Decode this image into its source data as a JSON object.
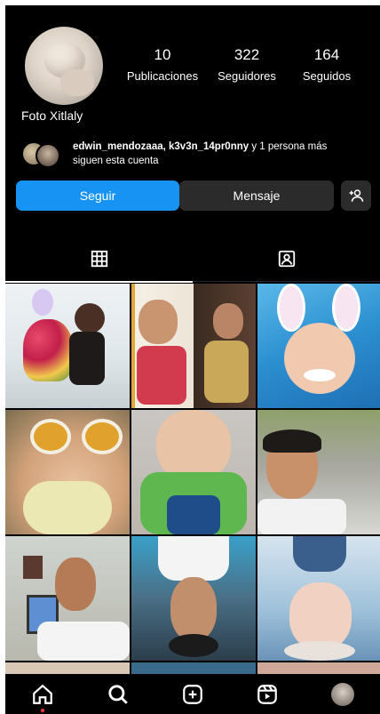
{
  "profile": {
    "name": "Foto Xitlaly",
    "stats": [
      {
        "value": "10",
        "label": "Publicaciones"
      },
      {
        "value": "322",
        "label": "Seguidores"
      },
      {
        "value": "164",
        "label": "Seguidos"
      }
    ],
    "followed_by": {
      "users": "edwin_mendozaaa, k3v3n_14pr0nny",
      "rest": "y 1 persona más",
      "line2": "siguen esta cuenta"
    }
  },
  "actions": {
    "follow_label": "Seguir",
    "message_label": "Mensaje",
    "suggest_icon": "add-person-icon"
  },
  "tabs": [
    {
      "icon": "grid-icon",
      "active": true
    },
    {
      "icon": "tagged-icon",
      "active": false
    }
  ],
  "grid": {
    "cells": [
      "photo-woman-flowers",
      "photo-child-portrait-and-woman",
      "photo-baby-bunny-filter",
      "photo-baby-sunglasses",
      "photo-baby-closeup",
      "photo-man-selfie",
      "photo-man-indoor",
      "photo-man-upside-down",
      "photo-woman-upside-down"
    ]
  },
  "bottom_nav": [
    {
      "icon": "home-icon",
      "active": true
    },
    {
      "icon": "search-icon"
    },
    {
      "icon": "add-post-icon"
    },
    {
      "icon": "reels-icon"
    },
    {
      "icon": "profile-avatar"
    }
  ],
  "colors": {
    "background": "#000000",
    "follow_button": "#1794f3",
    "secondary_button": "#2b2b2b",
    "notification_dot": "#ff3040"
  }
}
